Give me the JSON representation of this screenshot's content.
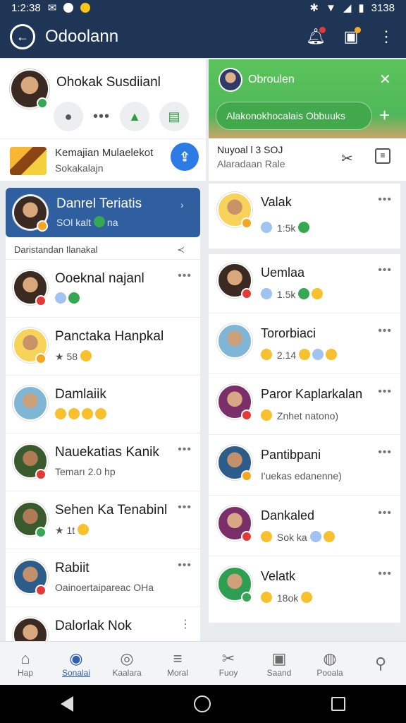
{
  "statusbar": {
    "time_left": "1:2:38",
    "time_right": "3138"
  },
  "appbar": {
    "title": "Odoolann"
  },
  "profile": {
    "title": "Ohokak Susdiianl",
    "sub1": "Kemajian Mulaelekot",
    "sub2": "Sokakalajn"
  },
  "green_panel": {
    "title": "Obroulen",
    "pill": "Alakonokhocalais Obbuuks",
    "close": "✕",
    "plus": "+"
  },
  "right_sub": {
    "line1": "Nuyoal l 3 SOJ",
    "line2": "Alaradaan  Rale"
  },
  "left_selected": {
    "name": "Danrel Teriatis",
    "sub": "SOl kalt",
    "sub_extra": "na"
  },
  "left_group_header": "Daristandan Ilanakal",
  "left_rows": [
    {
      "name": "Ooeknal najanl",
      "sub": ""
    },
    {
      "name": "Panctaka Hanpkal",
      "sub": "58"
    },
    {
      "name": "Damlaiik",
      "sub": ""
    },
    {
      "name": "Nauekatias Kanik",
      "sub": "Temarı    2.0 hp"
    },
    {
      "name": "Sehen Ka Tenabinl",
      "sub": "1t"
    },
    {
      "name": "Rabiit",
      "sub": "Oainoertaipareac OHa"
    },
    {
      "name": "Dalorlak Nok",
      "sub": ""
    }
  ],
  "right_top": {
    "name": "Valak",
    "sub": "1:5k"
  },
  "right_rows": [
    {
      "name": "Uemlaa",
      "sub": "1.5k"
    },
    {
      "name": "Tororbiaci",
      "sub": "2.14"
    },
    {
      "name": "Paror Kaplarkalan",
      "sub": "Znhet natono)"
    },
    {
      "name": "Pantibpani",
      "sub": "I'uekas edanenne)"
    },
    {
      "name": "Dankaled",
      "sub": "Sok ka"
    },
    {
      "name": "Velatk",
      "sub": "18ok"
    }
  ],
  "bottom_nav": [
    {
      "label": "Hap",
      "icon": "home-icon",
      "glyph": "⌂"
    },
    {
      "label": "Sonalai",
      "icon": "chat-icon",
      "glyph": "◉"
    },
    {
      "label": "Kaalara",
      "icon": "target-icon",
      "glyph": "◎"
    },
    {
      "label": "Moral",
      "icon": "menu-icon",
      "glyph": "≡"
    },
    {
      "label": "Fuoy",
      "icon": "tools-icon",
      "glyph": "✂"
    },
    {
      "label": "Saand",
      "icon": "inbox-icon",
      "glyph": "▣"
    },
    {
      "label": "Pooala",
      "icon": "music-icon",
      "glyph": "◍"
    },
    {
      "label": "",
      "icon": "search-icon",
      "glyph": "⚲"
    }
  ],
  "colors": {
    "appbar": "#1f3556",
    "selected": "#2f5f9e",
    "green": "#5cc45a",
    "accent": "#2c7be5"
  }
}
